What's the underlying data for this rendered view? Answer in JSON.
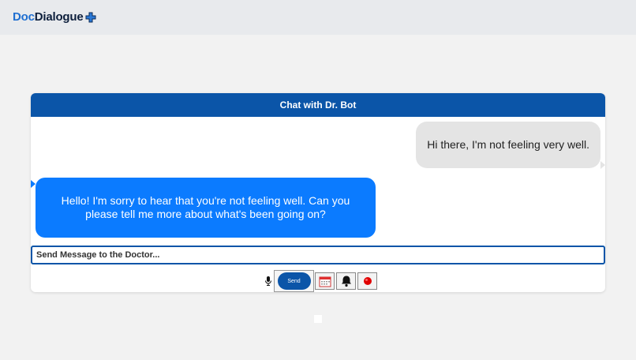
{
  "header": {
    "logo_part1": "Doc",
    "logo_part2": "Dialogue",
    "logo_icon": "cross-icon"
  },
  "chat": {
    "title": "Chat with Dr. Bot",
    "messages": [
      {
        "from": "user",
        "text": "Hi there, I'm not feeling very well."
      },
      {
        "from": "bot",
        "text": "Hello! I'm sorry to hear that you're not feeling well. Can you please tell me more about what's been going on?"
      }
    ],
    "input_placeholder": "Send Message to the Doctor...",
    "send_label": "Send",
    "icons": [
      "mic-icon",
      "calendar-icon",
      "bell-icon",
      "record-icon"
    ]
  },
  "colors": {
    "header_blue": "#0b55a8",
    "bot_bubble": "#0b7bff",
    "user_bubble": "#e4e4e4",
    "record_red": "#e00000"
  }
}
